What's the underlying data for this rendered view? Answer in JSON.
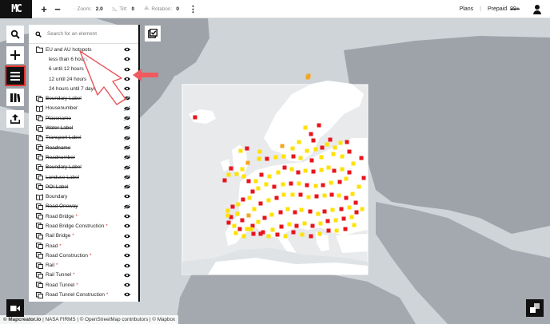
{
  "topbar": {
    "logo": "MC",
    "zoom_in": "+",
    "zoom_out": "−",
    "zoom_label": "Zoom:",
    "zoom_value": "2.0",
    "tilt_label": "Tilt:",
    "tilt_value": "0",
    "rotation_label": "Rotation:",
    "rotation_value": "0",
    "more": "⋮",
    "plans": "Plans",
    "separator": "|",
    "prepaid": "Prepaid",
    "prepaid_count": "99+"
  },
  "search": {
    "placeholder": "Search for an element"
  },
  "layers": [
    {
      "label": "EU and AU hotspots",
      "icon": "folder-icon",
      "type": "folder"
    },
    {
      "label": "less than 6 hours",
      "type": "child",
      "required": true
    },
    {
      "label": "6 until 12 hours",
      "type": "child"
    },
    {
      "label": "12 until 24 hours",
      "type": "child"
    },
    {
      "label": "24 hours until 7 days",
      "type": "child"
    },
    {
      "label": "Boundary Label",
      "icon": "layer-icon",
      "strike": true,
      "hidden": true
    },
    {
      "label": "Housenumber",
      "icon": "book-icon",
      "hidden": true
    },
    {
      "label": "Placename",
      "icon": "layer-icon",
      "strike": true,
      "hidden": true
    },
    {
      "label": "Water Label",
      "icon": "layer-icon",
      "strike": true,
      "hidden": true
    },
    {
      "label": "Transport Label",
      "icon": "layer-icon",
      "strike": true,
      "hidden": true
    },
    {
      "label": "Roadname",
      "icon": "layer-icon",
      "strike": true,
      "hidden": true
    },
    {
      "label": "Roadnumber",
      "icon": "layer-icon",
      "strike": true,
      "hidden": true
    },
    {
      "label": "Boundary Label",
      "icon": "layer-icon",
      "strike": true,
      "hidden": true
    },
    {
      "label": "Landuse Label",
      "icon": "layer-icon",
      "strike": true,
      "hidden": true
    },
    {
      "label": "POI Label",
      "icon": "layer-icon",
      "strike": true,
      "hidden": true
    },
    {
      "label": "Boundary",
      "icon": "book-icon"
    },
    {
      "label": "Road Oneway",
      "icon": "layer-icon",
      "strike": true,
      "hidden": true
    },
    {
      "label": "Road Bridge",
      "icon": "layer-icon",
      "required": true
    },
    {
      "label": "Road Bridge Construction",
      "icon": "layer-icon",
      "required": true
    },
    {
      "label": "Rail Bridge",
      "icon": "layer-icon",
      "required": true
    },
    {
      "label": "Road",
      "icon": "layer-icon",
      "required": true
    },
    {
      "label": "Road Construction",
      "icon": "layer-icon",
      "required": true
    },
    {
      "label": "Rail",
      "icon": "layer-icon",
      "required": true
    },
    {
      "label": "Rail Tunnel",
      "icon": "layer-icon",
      "required": true
    },
    {
      "label": "Road Tunnel",
      "icon": "layer-icon",
      "required": true
    },
    {
      "label": "Road Tunnel Construction",
      "icon": "layer-icon",
      "required": true
    }
  ],
  "required_marker": "*",
  "attribution": {
    "brand": "© Mapcreator.io",
    "rest": " | NASA FIRMS | © OpenStreetMap contributors | © Mapbox"
  },
  "colors": {
    "accent": "#e3342f",
    "hotspot_red": "#e8141c",
    "hotspot_orange": "#f7a41d",
    "hotspot_yellow": "#ffe100",
    "land": "#ffffff",
    "land_dim": "#9da3a8",
    "water": "#cfd4d8"
  },
  "map": {
    "hotspots": [
      [
        385,
        97,
        "o"
      ],
      [
        386,
        95,
        "o"
      ],
      [
        399,
        157,
        "r"
      ],
      [
        389,
        168,
        "r"
      ],
      [
        374,
        178,
        "y"
      ],
      [
        366,
        186,
        "y"
      ],
      [
        353,
        183,
        "o"
      ],
      [
        384,
        189,
        "y"
      ],
      [
        395,
        187,
        "y"
      ],
      [
        403,
        185,
        "r"
      ],
      [
        413,
        175,
        "r"
      ],
      [
        426,
        179,
        "y"
      ],
      [
        434,
        178,
        "r"
      ],
      [
        437,
        190,
        "r"
      ],
      [
        428,
        196,
        "y"
      ],
      [
        417,
        193,
        "y"
      ],
      [
        402,
        197,
        "y"
      ],
      [
        390,
        201,
        "r"
      ],
      [
        376,
        198,
        "y"
      ],
      [
        367,
        196,
        "r"
      ],
      [
        355,
        196,
        "y"
      ],
      [
        345,
        197,
        "y"
      ],
      [
        334,
        199,
        "r"
      ],
      [
        325,
        190,
        "y"
      ],
      [
        324,
        199,
        "y"
      ],
      [
        310,
        204,
        "o"
      ],
      [
        303,
        212,
        "y"
      ],
      [
        289,
        211,
        "r"
      ],
      [
        286,
        219,
        "y"
      ],
      [
        281,
        226,
        "r"
      ],
      [
        296,
        218,
        "y"
      ],
      [
        305,
        221,
        "y"
      ],
      [
        311,
        227,
        "r"
      ],
      [
        320,
        227,
        "y"
      ],
      [
        327,
        219,
        "r"
      ],
      [
        337,
        221,
        "y"
      ],
      [
        348,
        216,
        "y"
      ],
      [
        356,
        210,
        "r"
      ],
      [
        365,
        212,
        "y"
      ],
      [
        373,
        216,
        "r"
      ],
      [
        382,
        214,
        "y"
      ],
      [
        392,
        215,
        "r"
      ],
      [
        402,
        213,
        "y"
      ],
      [
        411,
        210,
        "y"
      ],
      [
        418,
        214,
        "r"
      ],
      [
        428,
        212,
        "y"
      ],
      [
        437,
        216,
        "r"
      ],
      [
        433,
        224,
        "y"
      ],
      [
        425,
        228,
        "r"
      ],
      [
        414,
        229,
        "y"
      ],
      [
        404,
        232,
        "r"
      ],
      [
        395,
        233,
        "y"
      ],
      [
        384,
        232,
        "r"
      ],
      [
        374,
        230,
        "y"
      ],
      [
        364,
        230,
        "r"
      ],
      [
        354,
        231,
        "y"
      ],
      [
        343,
        234,
        "r"
      ],
      [
        333,
        231,
        "y"
      ],
      [
        323,
        236,
        "y"
      ],
      [
        316,
        240,
        "r"
      ],
      [
        312,
        248,
        "y"
      ],
      [
        304,
        250,
        "r"
      ],
      [
        298,
        256,
        "y"
      ],
      [
        291,
        259,
        "r"
      ],
      [
        285,
        264,
        "y"
      ],
      [
        289,
        272,
        "r"
      ],
      [
        297,
        268,
        "y"
      ],
      [
        303,
        276,
        "r"
      ],
      [
        311,
        270,
        "o"
      ],
      [
        318,
        262,
        "y"
      ],
      [
        326,
        255,
        "r"
      ],
      [
        336,
        251,
        "y"
      ],
      [
        346,
        248,
        "r"
      ],
      [
        355,
        244,
        "y"
      ],
      [
        366,
        244,
        "y"
      ],
      [
        376,
        244,
        "r"
      ],
      [
        386,
        247,
        "y"
      ],
      [
        396,
        246,
        "r"
      ],
      [
        406,
        245,
        "y"
      ],
      [
        415,
        244,
        "r"
      ],
      [
        424,
        245,
        "y"
      ],
      [
        433,
        248,
        "r"
      ],
      [
        441,
        243,
        "y"
      ],
      [
        445,
        254,
        "r"
      ],
      [
        437,
        260,
        "y"
      ],
      [
        427,
        262,
        "r"
      ],
      [
        416,
        263,
        "y"
      ],
      [
        406,
        265,
        "r"
      ],
      [
        398,
        268,
        "y"
      ],
      [
        388,
        265,
        "r"
      ],
      [
        377,
        263,
        "y"
      ],
      [
        369,
        266,
        "r"
      ],
      [
        360,
        262,
        "y"
      ],
      [
        351,
        266,
        "r"
      ],
      [
        340,
        269,
        "y"
      ],
      [
        331,
        273,
        "r"
      ],
      [
        323,
        278,
        "y"
      ],
      [
        316,
        283,
        "r"
      ],
      [
        309,
        287,
        "y"
      ],
      [
        300,
        287,
        "r"
      ],
      [
        293,
        283,
        "y"
      ],
      [
        286,
        279,
        "r"
      ],
      [
        285,
        270,
        "y"
      ],
      [
        295,
        292,
        "y"
      ],
      [
        305,
        296,
        "y"
      ],
      [
        317,
        293,
        "r"
      ],
      [
        329,
        291,
        "r"
      ],
      [
        341,
        288,
        "y"
      ],
      [
        352,
        284,
        "r"
      ],
      [
        362,
        281,
        "y"
      ],
      [
        371,
        283,
        "r"
      ],
      [
        381,
        280,
        "y"
      ],
      [
        391,
        283,
        "r"
      ],
      [
        401,
        280,
        "y"
      ],
      [
        410,
        277,
        "r"
      ],
      [
        420,
        276,
        "y"
      ],
      [
        430,
        274,
        "r"
      ],
      [
        440,
        272,
        "y"
      ],
      [
        446,
        266,
        "r"
      ],
      [
        453,
        262,
        "y"
      ],
      [
        443,
        282,
        "y"
      ],
      [
        432,
        287,
        "r"
      ],
      [
        421,
        289,
        "y"
      ],
      [
        411,
        289,
        "r"
      ],
      [
        400,
        293,
        "y"
      ],
      [
        389,
        296,
        "r"
      ],
      [
        378,
        294,
        "y"
      ],
      [
        367,
        291,
        "r"
      ],
      [
        357,
        296,
        "y"
      ],
      [
        347,
        294,
        "r"
      ],
      [
        336,
        296,
        "y"
      ],
      [
        326,
        293,
        "r"
      ],
      [
        314,
        287,
        "y"
      ],
      [
        244,
        147,
        "r"
      ],
      [
        301,
        189,
        "y"
      ],
      [
        309,
        186,
        "r"
      ],
      [
        449,
        234,
        "y"
      ],
      [
        455,
        223,
        "r"
      ],
      [
        442,
        205,
        "y"
      ],
      [
        452,
        198,
        "r"
      ],
      [
        419,
        185,
        "y"
      ],
      [
        409,
        181,
        "y"
      ],
      [
        382,
        160,
        "y"
      ],
      [
        392,
        176,
        "r"
      ]
    ]
  }
}
